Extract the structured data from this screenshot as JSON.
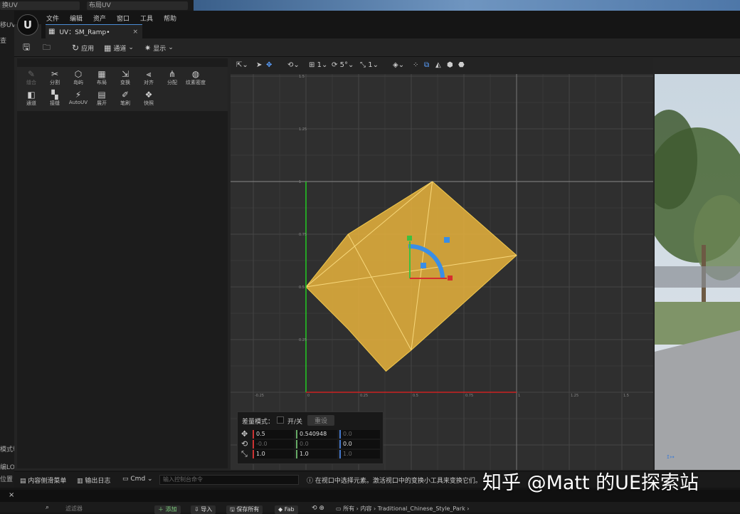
{
  "background_fragments": {
    "top_left_1": "换UV",
    "top_left_2": "布局UV",
    "left_1": "移UV",
    "left_2": "查",
    "left_3": "模式切",
    "left_4": "编LOD",
    "left_5": "位置"
  },
  "app": {
    "logo_text": "U"
  },
  "menu": [
    "文件",
    "编辑",
    "资产",
    "窗口",
    "工具",
    "帮助"
  ],
  "tab": {
    "title": "UV：SM_Ramp•",
    "close": "×"
  },
  "toolbar": {
    "apply": "应用",
    "channel": "通道",
    "display": "显示"
  },
  "tools": [
    {
      "label": "缝合",
      "icon": "✎",
      "enabled": false
    },
    {
      "label": "分割",
      "icon": "✂",
      "enabled": true
    },
    {
      "label": "岛屿",
      "icon": "⬡",
      "enabled": true
    },
    {
      "label": "布局",
      "icon": "▦",
      "enabled": true
    },
    {
      "label": "变换",
      "icon": "⇲",
      "enabled": true
    },
    {
      "label": "对齐",
      "icon": "⫷",
      "enabled": true
    },
    {
      "label": "分配",
      "icon": "⋔",
      "enabled": true
    },
    {
      "label": "纹素密度",
      "icon": "◍",
      "enabled": true
    },
    {
      "label": "通道",
      "icon": "◧",
      "enabled": true
    },
    {
      "label": "接缝",
      "icon": "▚",
      "enabled": true
    },
    {
      "label": "AutoUV",
      "icon": "⚡",
      "enabled": true
    },
    {
      "label": "展开",
      "icon": "▤",
      "enabled": true
    },
    {
      "label": "笔刷",
      "icon": "✐",
      "enabled": true
    },
    {
      "label": "快照",
      "icon": "❖",
      "enabled": true
    }
  ],
  "viewport_toolbar": {
    "grid_step": "1",
    "rotate_snap": "5°",
    "scale_snap": "1"
  },
  "grid": {
    "x_ticks": [
      "-0.25",
      "0",
      "0.25",
      "0.5",
      "0.75",
      "1",
      "1.25",
      "1.5"
    ],
    "y_ticks": [
      "1.5",
      "1.25",
      "1",
      "0.75",
      "0.5",
      "0.25"
    ],
    "uv_polygon": [
      [
        0,
        0.5
      ],
      [
        0.2,
        0.75
      ],
      [
        0.6,
        1
      ],
      [
        1,
        0.65
      ],
      [
        0.5,
        0.2
      ],
      [
        0.38,
        0.1
      ],
      [
        0.2,
        0.3
      ]
    ]
  },
  "quantity_panel": {
    "mode_label": "差量模式：",
    "toggle_label": "开/关",
    "reset_label": "重设",
    "rows": [
      {
        "icon": "move-icon",
        "x": "0.5",
        "y": "0.540948",
        "z": "0.0"
      },
      {
        "icon": "rotate-icon",
        "x": "-0.0",
        "y": "0.0",
        "z": "0.0"
      },
      {
        "icon": "scale-icon",
        "x": "1.0",
        "y": "1.0",
        "z": "1.0"
      }
    ]
  },
  "statusbar": {
    "content_drawer": "内容侧滑菜单",
    "output_log": "输出日志",
    "cmd": "Cmd",
    "cmd_placeholder": "输入控制台命令",
    "hint": "在视口中选择元素。激活视口中的变换小工具来变换它们。"
  },
  "bottom": {
    "close": "×",
    "filter": "滤滤器",
    "add": "添加",
    "import": "导入",
    "save_all": "保存所有",
    "fab": "Fab",
    "breadcrumb": [
      "所有",
      "内容",
      "Traditional_Chinese_Style_Park"
    ]
  },
  "watermark": "知乎 @Matt 的UE探索站",
  "colors": {
    "accent": "#4b8bd4",
    "uv_fill": "#e8b33c",
    "uv_edge": "#f2c94c",
    "u_axis": "#cc2222",
    "v_axis": "#22cc22"
  }
}
